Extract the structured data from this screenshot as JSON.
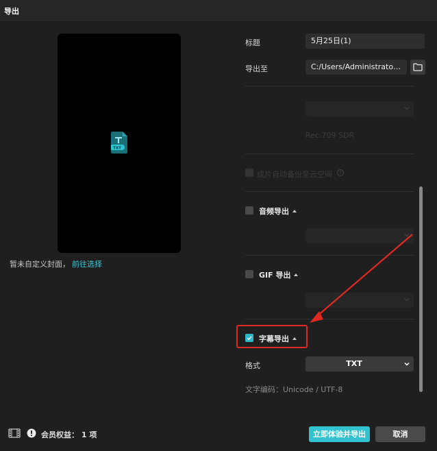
{
  "window": {
    "title": "导出"
  },
  "preview": {
    "file_badge": "TXT",
    "cover_note": "暂未自定义封面，",
    "cover_link": "前往选择"
  },
  "form": {
    "title_label": "标题",
    "title_value": "5月25日(1)",
    "export_to_label": "导出至",
    "export_path": "C:/Users/Administrator..."
  },
  "video_settings": {
    "color_space": "Rec.709 SDR"
  },
  "cloud_backup": {
    "label": "成片自动备份至云空间",
    "help": "?"
  },
  "audio_export": {
    "label": "音频导出",
    "checked": false
  },
  "gif_export": {
    "label": "GIF 导出",
    "checked": false
  },
  "subtitle_export": {
    "label": "字幕导出",
    "checked": true,
    "format_label": "格式",
    "format_value": "TXT",
    "encoding": "文字编码：Unicode / UTF-8"
  },
  "footer": {
    "member_text": "会员权益：  1 项",
    "primary_button": "立即体验并导出",
    "cancel_button": "取消"
  },
  "colors": {
    "accent": "#33c2cf",
    "highlight": "#e02a21"
  }
}
